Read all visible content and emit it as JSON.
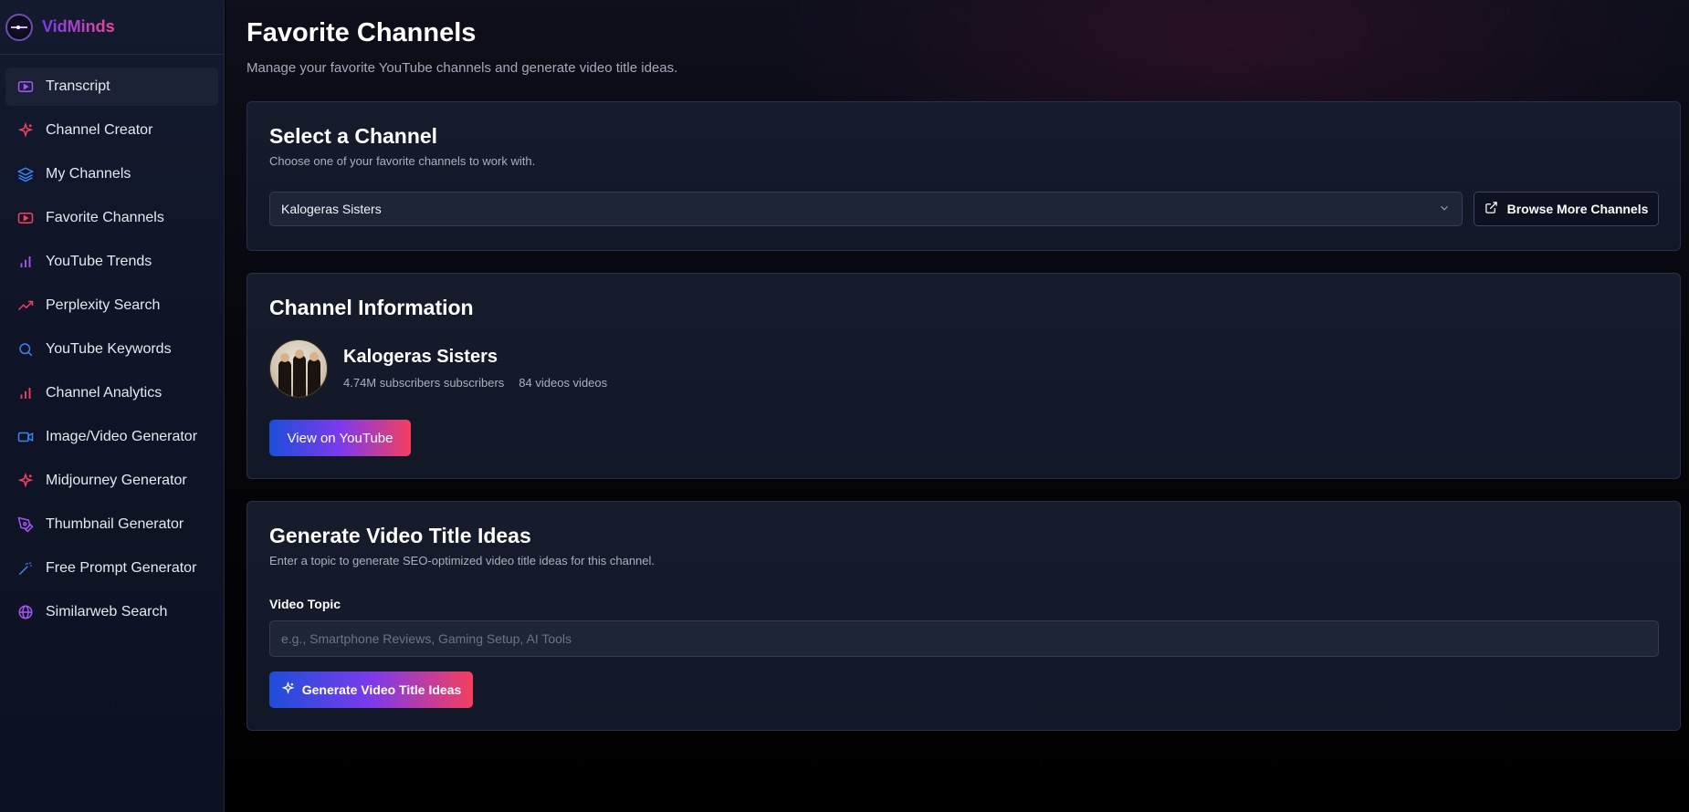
{
  "app": {
    "name": "VidMinds"
  },
  "sidebar": {
    "items": [
      {
        "label": "Transcript",
        "icon": "youtube-icon",
        "color": "#a855f7",
        "active": true
      },
      {
        "label": "Channel Creator",
        "icon": "sparkles-icon",
        "color": "#f43f5e"
      },
      {
        "label": "My Channels",
        "icon": "layers-icon",
        "color": "#3b82f6"
      },
      {
        "label": "Favorite Channels",
        "icon": "youtube-icon",
        "color": "#f43f5e"
      },
      {
        "label": "YouTube Trends",
        "icon": "bar-chart-icon",
        "color": "#a855f7"
      },
      {
        "label": "Perplexity Search",
        "icon": "trending-up-icon",
        "color": "#f43f5e"
      },
      {
        "label": "YouTube Keywords",
        "icon": "search-icon",
        "color": "#3b82f6"
      },
      {
        "label": "Channel Analytics",
        "icon": "bar-chart-icon",
        "color": "#f43f5e"
      },
      {
        "label": "Image/Video Generator",
        "icon": "video-icon",
        "color": "#3b82f6"
      },
      {
        "label": "Midjourney Generator",
        "icon": "sparkles-icon",
        "color": "#f43f5e"
      },
      {
        "label": "Thumbnail Generator",
        "icon": "pen-tool-icon",
        "color": "#a855f7"
      },
      {
        "label": "Free Prompt Generator",
        "icon": "wand-icon",
        "color": "#3b82f6"
      },
      {
        "label": "Similarweb Search",
        "icon": "globe-icon",
        "color": "#a855f7"
      }
    ]
  },
  "header": {
    "title": "Favorite Channels",
    "subtitle": "Manage your favorite YouTube channels and generate video title ideas."
  },
  "select_channel": {
    "title": "Select a Channel",
    "subtitle": "Choose one of your favorite channels to work with.",
    "selected": "Kalogeras Sisters",
    "browse_label": "Browse More Channels"
  },
  "channel_info": {
    "title": "Channel Information",
    "name": "Kalogeras Sisters",
    "subscribers": "4.74M subscribers subscribers",
    "videos": "84 videos videos",
    "view_button": "View on YouTube"
  },
  "generate": {
    "title": "Generate Video Title Ideas",
    "subtitle": "Enter a topic to generate SEO-optimized video title ideas for this channel.",
    "field_label": "Video Topic",
    "placeholder": "e.g., Smartphone Reviews, Gaming Setup, AI Tools",
    "value": "",
    "button_label": "Generate Video Title Ideas"
  },
  "colors": {
    "accent_gradient": [
      "#1d4ed8",
      "#7c3aed",
      "#f43f5e"
    ],
    "brand_gradient": [
      "#7c3aed",
      "#ec4899"
    ]
  }
}
